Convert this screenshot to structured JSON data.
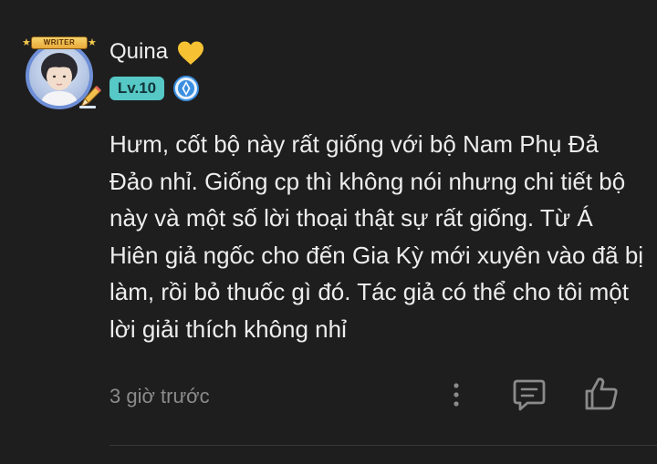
{
  "comment": {
    "author": {
      "name": "Quina",
      "name_emoji": "💛",
      "avatar_badge_text": "WRITER",
      "level": "Lv.10"
    },
    "text": "Hưm, cốt bộ này rất giống với bộ Nam Phụ Đả Đảo nhỉ. Giống cp thì không nói nhưng chi tiết bộ này và một số lời thoại thật sự rất giống. Từ Á Hiên giả ngốc cho đến Gia Kỳ mới xuyên vào đã bị làm, rồi bỏ thuốc gì đó. Tác giả có thể cho tôi một lời giải thích không nhỉ",
    "timestamp": "3 giờ trước",
    "actions": {
      "more": "more-vertical-icon",
      "reply": "reply-comment-icon",
      "like": "thumbs-up-icon"
    }
  },
  "colors": {
    "background": "#1e1e1e",
    "text": "#ededed",
    "muted": "#8b8b8b",
    "level_badge": "#56c8c6",
    "rank_icon": "#3a8fe0",
    "heart": "#f6c233"
  }
}
